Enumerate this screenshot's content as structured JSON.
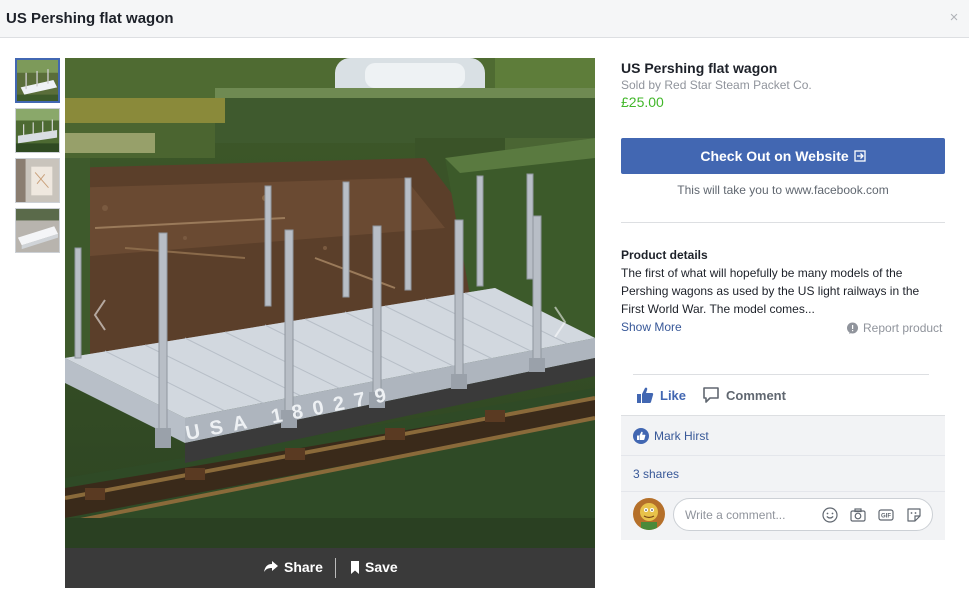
{
  "header": {
    "title": "US Pershing flat wagon",
    "close_label": "×"
  },
  "gallery": {
    "thumbnails": [
      "photo-1",
      "photo-2",
      "photo-3",
      "photo-4"
    ],
    "selected_index": 0,
    "main_image_text": "USA 180279"
  },
  "image_actions": {
    "share_label": "Share",
    "save_label": "Save"
  },
  "product": {
    "title": "US Pershing flat wagon",
    "seller": "Sold by Red Star Steam Packet Co.",
    "price": "£25.00",
    "checkout_label": "Check Out on Website",
    "checkout_note": "This will take you to www.facebook.com",
    "details_heading": "Product details",
    "details_text": "The first of what will hopefully be many models of the Pershing wagons as used by the US light railways in the First World War. The model comes...",
    "show_more": "Show More",
    "report": "Report product"
  },
  "actions": {
    "like_label": "Like",
    "comment_label": "Comment"
  },
  "social": {
    "liker": "Mark Hirst",
    "shares": "3 shares",
    "comment_placeholder": "Write a comment...",
    "gif_label": "GIF"
  },
  "colors": {
    "accent": "#4267b2",
    "price": "#42b72a",
    "link": "#385898"
  },
  "icons": [
    "close-icon",
    "chevron-left-icon",
    "chevron-right-icon",
    "share-arrow-icon",
    "bookmark-icon",
    "external-link-icon",
    "report-icon",
    "thumbs-up-icon",
    "comment-bubble-icon",
    "like-badge-icon",
    "smiley-icon",
    "camera-icon",
    "gif-icon",
    "sticker-icon"
  ]
}
